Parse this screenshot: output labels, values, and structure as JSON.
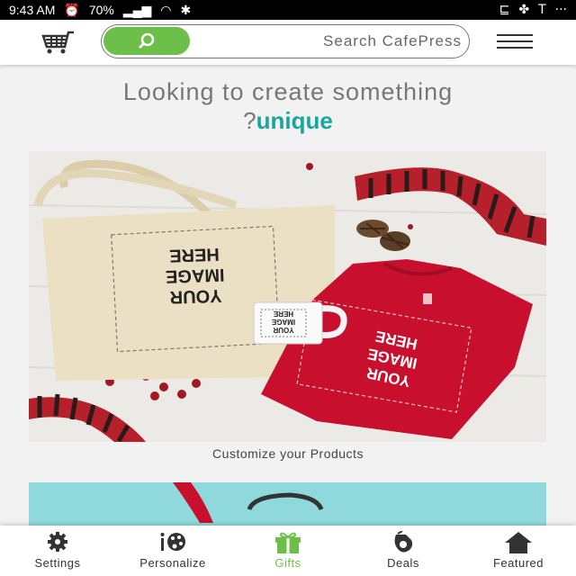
{
  "status_bar": {
    "time": "9:43 AM",
    "battery": "70%",
    "dots": "···",
    "icons_left": [
      "alarm-icon",
      "signal-icon",
      "wifi-icon",
      "bluetooth-icon"
    ],
    "icons_right": [
      "cast-icon",
      "fan-icon",
      "t-icon"
    ]
  },
  "header": {
    "search_placeholder": "Search CafePress",
    "accent_color": "#6cc04a"
  },
  "headline": {
    "line1": "Looking to create something",
    "highlight": "unique",
    "question_mark": "?",
    "highlight_color": "#19a6a1"
  },
  "product": {
    "tote_text": "YOUR IMAGE HERE",
    "mug_text": "YOUR IMAGE HERE",
    "shirt_text": "YOUR IMAGE HERE",
    "caption": "Customize your Products"
  },
  "bottom_nav": {
    "items": [
      {
        "label": "Settings",
        "icon": "gear-icon"
      },
      {
        "label": "Personalize",
        "icon": "palette-icon"
      },
      {
        "label": "Gifts",
        "icon": "gift-icon"
      },
      {
        "label": "Deals",
        "icon": "tag-icon"
      },
      {
        "label": "Featured",
        "icon": "home-icon"
      }
    ],
    "active_index": 2
  }
}
